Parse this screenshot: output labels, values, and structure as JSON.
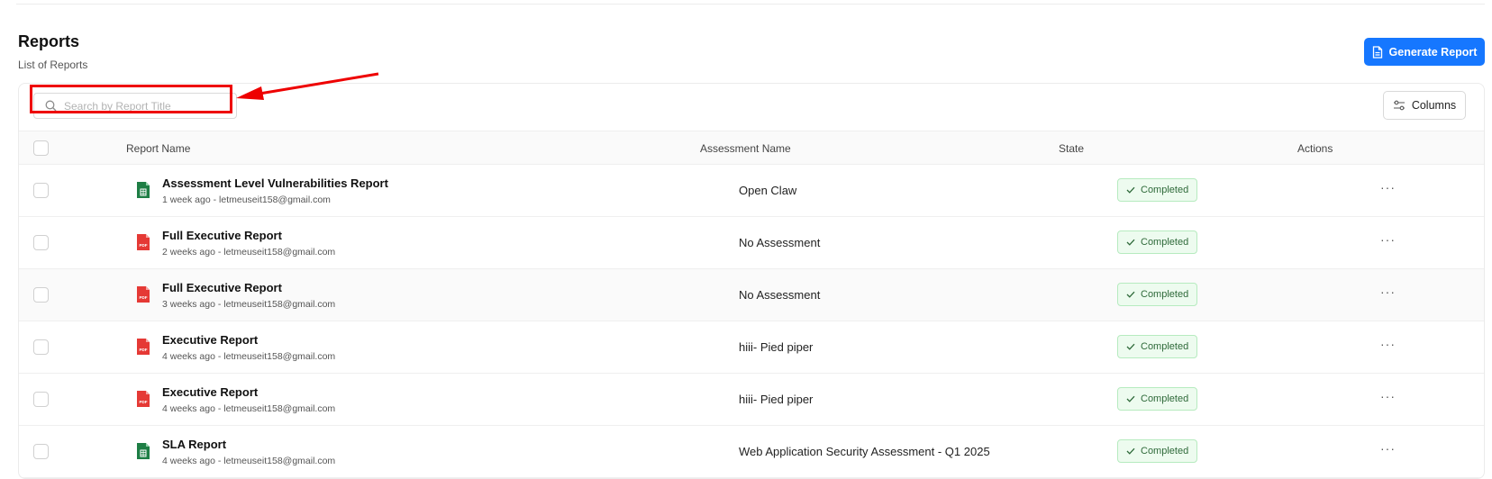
{
  "header": {
    "title": "Reports",
    "subtitle": "List of Reports",
    "generate_label": "Generate Report"
  },
  "toolbar": {
    "search_placeholder": "Search by Report Title",
    "columns_label": "Columns"
  },
  "table": {
    "columns": [
      "Report Name",
      "Assessment Name",
      "State",
      "Actions"
    ],
    "rows": [
      {
        "name": "Assessment Level Vulnerabilities Report",
        "meta": "1 week ago - letmeuseit158@gmail.com",
        "assessment": "Open Claw",
        "state": "Completed",
        "file_type": "sheet-icon"
      },
      {
        "name": "Full Executive Report",
        "meta": "2 weeks ago - letmeuseit158@gmail.com",
        "assessment": "No Assessment",
        "state": "Completed",
        "file_type": "pdf-icon"
      },
      {
        "name": "Full Executive Report",
        "meta": "3 weeks ago - letmeuseit158@gmail.com",
        "assessment": "No Assessment",
        "state": "Completed",
        "file_type": "pdf-icon"
      },
      {
        "name": "Executive Report",
        "meta": "4 weeks ago - letmeuseit158@gmail.com",
        "assessment": "hiii- Pied piper",
        "state": "Completed",
        "file_type": "pdf-icon"
      },
      {
        "name": "Executive Report",
        "meta": "4 weeks ago - letmeuseit158@gmail.com",
        "assessment": "hiii- Pied piper",
        "state": "Completed",
        "file_type": "pdf-icon"
      },
      {
        "name": "SLA Report",
        "meta": "4 weeks ago - letmeuseit158@gmail.com",
        "assessment": "Web Application Security Assessment - Q1 2025",
        "state": "Completed",
        "file_type": "sheet-icon"
      }
    ],
    "actions_glyph": "···"
  },
  "icons": {
    "pdf_label": "PDF"
  },
  "colors": {
    "primary": "#1677ff",
    "success_bg": "#edfbef",
    "success_text": "#2f6a3a",
    "pdf": "#e53935",
    "sheet": "#1e7e45",
    "callout": "#ee0000"
  }
}
